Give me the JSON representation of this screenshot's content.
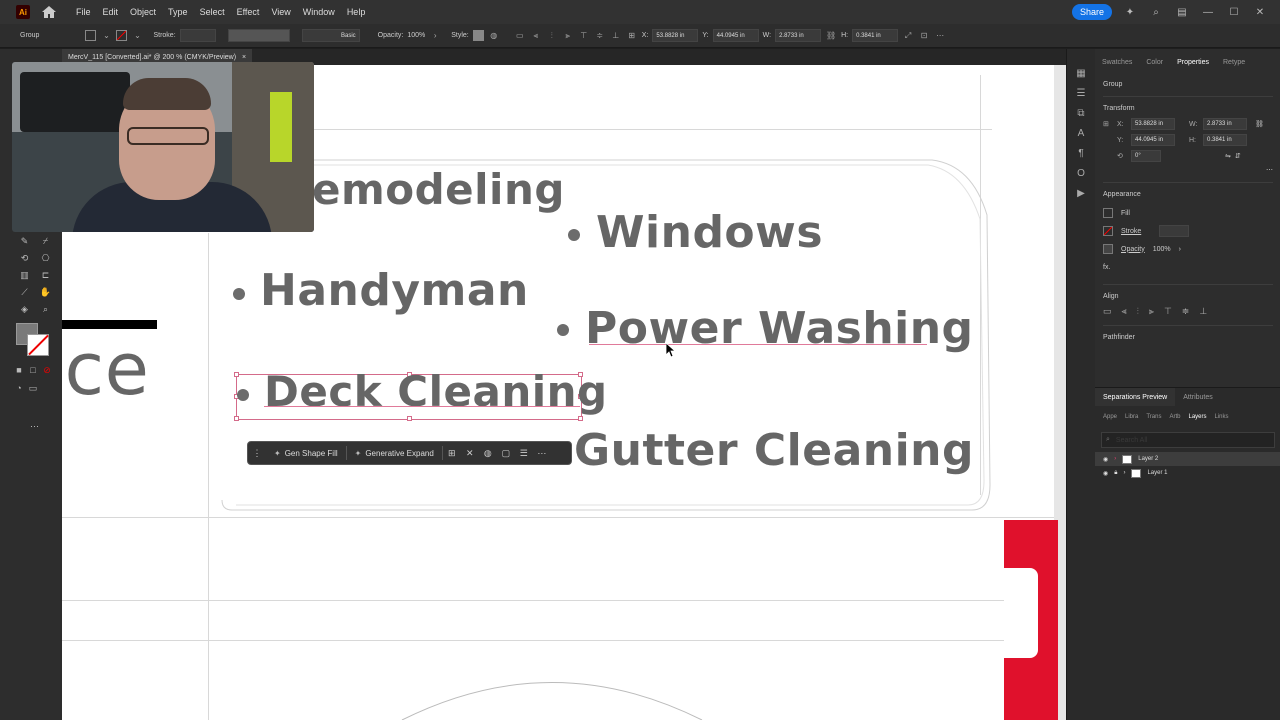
{
  "app": {
    "logo": "Ai",
    "menu": [
      "File",
      "Edit",
      "Object",
      "Type",
      "Select",
      "Effect",
      "View",
      "Window",
      "Help"
    ],
    "share_label": "Share"
  },
  "control_bar": {
    "object_type": "Group",
    "stroke_label": "Stroke:",
    "brush": "Basic",
    "opacity_label": "Opacity:",
    "opacity_value": "100%",
    "style_label": "Style:",
    "x_label": "X:",
    "x_value": "53.8828 in",
    "y_label": "Y:",
    "y_value": "44.0945 in",
    "w_label": "W:",
    "w_value": "2.8733 in",
    "h_label": "H:",
    "h_value": "0.3841 in"
  },
  "document": {
    "tab_title": "MercV_115 [Converted].ai* @ 200 % (CMYK/Preview)",
    "close": "×"
  },
  "canvas": {
    "words": {
      "remodeling": "emodeling",
      "windows": "Windows",
      "handyman": "Handyman",
      "power_washing": "Power Washing",
      "deck_cleaning": "Deck Cleaning",
      "gutter_cleaning": "Gutter Cleaning",
      "ice": "ice"
    }
  },
  "context_bar": {
    "gen_shape_fill": "Gen Shape Fill",
    "generative_expand": "Generative Expand"
  },
  "right_panel": {
    "tabs": [
      "Swatches",
      "Color",
      "Properties",
      "Retype"
    ],
    "active_tab": "Properties",
    "object_type": "Group",
    "transform_title": "Transform",
    "x_label": "X:",
    "x_value": "53.8828 in",
    "y_label": "Y:",
    "y_value": "44.0945 in",
    "w_label": "W:",
    "w_value": "2.8733 in",
    "h_label": "H:",
    "h_value": "0.3841 in",
    "rotate_value": "0°",
    "appearance_title": "Appearance",
    "fill_label": "Fill",
    "stroke_label": "Stroke",
    "opacity_label": "Opacity",
    "opacity_value": "100%",
    "fx_label": "fx.",
    "align_title": "Align",
    "pathfinder_title": "Pathfinder"
  },
  "bottom_panel": {
    "tabs": [
      "Separations Preview",
      "Attributes"
    ],
    "layer_tabs": [
      "Appe",
      "Libra",
      "Trans",
      "Artb",
      "Layers",
      "Links"
    ],
    "active_layer_tab": "Layers",
    "search_placeholder": "Search All",
    "layers": [
      {
        "name": "Layer 2",
        "selected": true
      },
      {
        "name": "Layer 1",
        "selected": false
      }
    ]
  },
  "colors": {
    "accent": "#1473e6",
    "selection": "#d46b8a",
    "text_gray": "#666666",
    "red_shape": "#e0112c"
  }
}
